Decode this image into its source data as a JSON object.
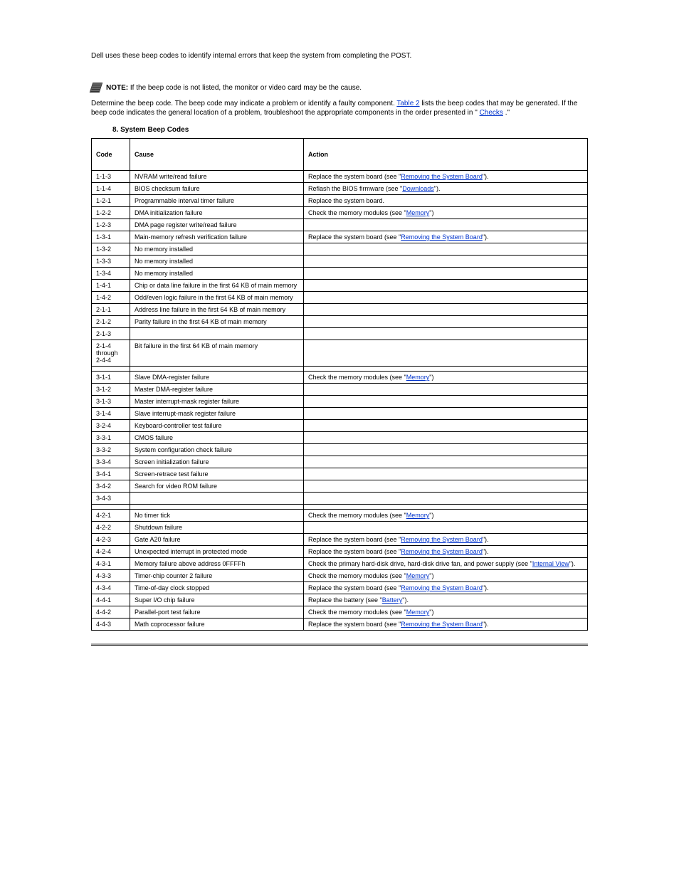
{
  "intro": {
    "p1a": "Determine the beep code. The beep code may indicate a problem or identify a faulty component. ",
    "p1_link": "Table 2",
    "p1b": " lists the beep codes that may be generated. If the beep code indicates the general location of a problem, troubleshoot the appropriate components in the order presented in \"",
    "p1_link2": "Checks",
    "p1c": ".\""
  },
  "note_label": "NOTE: ",
  "note_text": "If the beep code is not listed, the monitor or video card may be the cause.",
  "table_caption": "8. System Beep Codes",
  "headers": {
    "code": "Code",
    "cause": "Cause",
    "action": "Action"
  },
  "rows": [
    {
      "code": "1-1-3",
      "cause": "NVRAM write/read failure",
      "action": [
        {
          "t": "Replace the system board (see \""
        },
        {
          "t": "Removing the System Board",
          "l": true
        },
        {
          "t": "\")."
        }
      ]
    },
    {
      "code": "1-1-4",
      "cause": "BIOS checksum failure",
      "action": [
        {
          "t": "Reflash the BIOS firmware (see \""
        },
        {
          "t": "Downloads",
          "l": true
        },
        {
          "t": "\")."
        }
      ]
    },
    {
      "code": "1-2-1",
      "cause": "Programmable interval timer failure",
      "action": [
        {
          "t": "Replace the system board."
        }
      ]
    },
    {
      "code": "1-2-2",
      "cause": "DMA initialization failure",
      "action": [
        {
          "t": "Check the memory modules (see \""
        },
        {
          "t": "Memory",
          "l": true
        },
        {
          "t": "\")"
        }
      ]
    },
    {
      "code": "1-2-3",
      "cause": "DMA page register write/read failure",
      "action": []
    },
    {
      "code": "1-3-1",
      "cause": "Main-memory refresh verification failure",
      "action": [
        {
          "t": "Replace the system board (see \""
        },
        {
          "t": "Removing the System Board",
          "l": true
        },
        {
          "t": "\")."
        }
      ]
    },
    {
      "code": "1-3-2",
      "cause": "No memory installed",
      "action": []
    },
    {
      "code": "1-3-3",
      "cause": "No memory installed",
      "action": []
    },
    {
      "code": "1-3-4",
      "cause": "No memory installed",
      "action": []
    },
    {
      "code": "1-4-1",
      "cause": "Chip or data line failure in the first 64 KB of main memory",
      "action": []
    },
    {
      "code": "1-4-2",
      "cause": "Odd/even logic failure in the first 64 KB of main memory",
      "action": []
    },
    {
      "code": "2-1-1",
      "cause": "Address line failure in the first 64 KB of main memory",
      "action": []
    },
    {
      "code": "2-1-2",
      "cause": "Parity failure in the first 64 KB of main memory",
      "action": []
    },
    {
      "code": "2-1-3",
      "cause": "",
      "action": []
    },
    {
      "code": "2-1-4 through 2-4-4",
      "cause": "Bit failure in the first 64 KB of main memory",
      "action": []
    },
    {
      "code": "",
      "cause": "",
      "action": []
    },
    {
      "code": "3-1-1",
      "cause": "Slave DMA-register failure",
      "action": [
        {
          "t": "Check the memory modules (see \""
        },
        {
          "t": "Memory",
          "l": true
        },
        {
          "t": "\")"
        }
      ]
    },
    {
      "code": "3-1-2",
      "cause": "Master DMA-register failure",
      "action": []
    },
    {
      "code": "3-1-3",
      "cause": "Master interrupt-mask register failure",
      "action": []
    },
    {
      "code": "3-1-4",
      "cause": "Slave interrupt-mask register failure",
      "action": []
    },
    {
      "code": "3-2-4",
      "cause": "Keyboard-controller test failure",
      "action": []
    },
    {
      "code": "3-3-1",
      "cause": "CMOS failure",
      "action": []
    },
    {
      "code": "3-3-2",
      "cause": "System configuration check failure",
      "action": []
    },
    {
      "code": "3-3-4",
      "cause": "Screen initialization failure",
      "action": []
    },
    {
      "code": "3-4-1",
      "cause": "Screen-retrace test failure",
      "action": []
    },
    {
      "code": "3-4-2",
      "cause": "Search for video ROM failure",
      "action": []
    },
    {
      "code": "3-4-3",
      "cause": "",
      "action": []
    },
    {
      "code": "",
      "cause": "",
      "action": []
    },
    {
      "code": "4-2-1",
      "cause": "No timer tick",
      "action": [
        {
          "t": "Check the memory modules (see \""
        },
        {
          "t": "Memory",
          "l": true
        },
        {
          "t": "\")"
        }
      ]
    },
    {
      "code": "4-2-2",
      "cause": "Shutdown failure",
      "action": []
    },
    {
      "code": "4-2-3",
      "cause": "Gate A20 failure",
      "action": [
        {
          "t": "Replace the system board (see \""
        },
        {
          "t": "Removing the System Board",
          "l": true
        },
        {
          "t": "\")."
        }
      ]
    },
    {
      "code": "4-2-4",
      "cause": "Unexpected interrupt in protected mode",
      "action": [
        {
          "t": "Replace the system board (see \""
        },
        {
          "t": "Removing the System Board",
          "l": true
        },
        {
          "t": "\")."
        }
      ]
    },
    {
      "code": "4-3-1",
      "cause": "Memory failure above address 0FFFFh",
      "action": [
        {
          "t": "Check the primary hard-disk drive, hard-disk drive fan, and power supply (see \""
        },
        {
          "t": "Internal View",
          "l": true
        },
        {
          "t": "\")."
        }
      ]
    },
    {
      "code": "4-3-3",
      "cause": "Timer-chip counter 2 failure",
      "action": [
        {
          "t": "Check the memory modules (see \""
        },
        {
          "t": "Memory",
          "l": true
        },
        {
          "t": "\")"
        }
      ]
    },
    {
      "code": "4-3-4",
      "cause": "Time-of-day clock stopped",
      "action": [
        {
          "t": "Replace the system board (see \""
        },
        {
          "t": "Removing the System Board",
          "l": true
        },
        {
          "t": "\")."
        }
      ]
    },
    {
      "code": "4-4-1",
      "cause": "Super I/O chip failure",
      "action": [
        {
          "t": "Replace the battery (see \""
        },
        {
          "t": "Battery",
          "l": true
        },
        {
          "t": "\")."
        }
      ]
    },
    {
      "code": "4-4-2",
      "cause": "Parallel-port test failure",
      "action": [
        {
          "t": "Check the memory modules (see \""
        },
        {
          "t": "Memory",
          "l": true
        },
        {
          "t": "\")"
        }
      ]
    },
    {
      "code": "4-4-3",
      "cause": "Math coprocessor failure",
      "action": [
        {
          "t": "Replace the system board (see \""
        },
        {
          "t": "Removing the System Board",
          "l": true
        },
        {
          "t": "\")."
        }
      ]
    }
  ]
}
